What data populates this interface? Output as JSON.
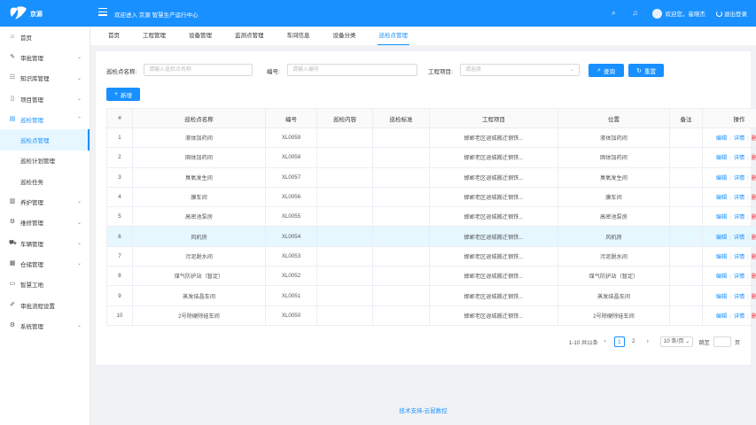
{
  "header": {
    "logo_text": "京源",
    "welcome": "欢迎进入 京源 智慧生产运行中心",
    "user_greeting": "欢迎您，崔晓杰",
    "logout": "退出登录",
    "brand_color": "#1890ff"
  },
  "sidebar": {
    "items": [
      {
        "label": "首页",
        "icon": "home-icon",
        "glyph": "⌂",
        "chevron": ""
      },
      {
        "label": "审批管理",
        "icon": "approval-icon",
        "glyph": "✎",
        "chevron": "⌄"
      },
      {
        "label": "知识库管理",
        "icon": "library-icon",
        "glyph": "☷",
        "chevron": "⌄"
      },
      {
        "label": "项目管理",
        "icon": "project-icon",
        "glyph": "▯",
        "chevron": "⌄"
      },
      {
        "label": "巡检管理",
        "icon": "inspection-icon",
        "glyph": "▤",
        "chevron": "⌃"
      }
    ],
    "sub_items": [
      {
        "label": "巡检点管理"
      },
      {
        "label": "巡检计划管理"
      },
      {
        "label": "巡检任务"
      }
    ],
    "items_after": [
      {
        "label": "养护管理",
        "icon": "maintenance-icon",
        "glyph": "▥",
        "chevron": "⌄"
      },
      {
        "label": "维修管理",
        "icon": "repair-icon",
        "glyph": "⚙",
        "chevron": "⌄"
      },
      {
        "label": "车辆管理",
        "icon": "vehicle-icon",
        "glyph": "⛟",
        "chevron": "⌄"
      },
      {
        "label": "仓储管理",
        "icon": "warehouse-icon",
        "glyph": "▦",
        "chevron": "⌄"
      },
      {
        "label": "智慧工地",
        "icon": "site-icon",
        "glyph": "▭",
        "chevron": ""
      },
      {
        "label": "审批流程设置",
        "icon": "workflow-icon",
        "glyph": "✐",
        "chevron": ""
      },
      {
        "label": "系统管理",
        "icon": "settings-icon",
        "glyph": "⚙",
        "chevron": "⌄"
      }
    ]
  },
  "tabs": [
    "首页",
    "工程管理",
    "设备管理",
    "监测点管理",
    "车间信息",
    "设备分类",
    "巡检点管理"
  ],
  "filters": {
    "name_label": "巡检点名称:",
    "name_placeholder": "请输入巡检点名称",
    "code_label": "编号:",
    "code_placeholder": "请输入编号",
    "project_label": "工程项目:",
    "project_placeholder": "请选择",
    "search_button": "查询",
    "reset_button": "重置",
    "add_button": "新增"
  },
  "table": {
    "columns": [
      "#",
      "巡检点名称",
      "编号",
      "巡检内容",
      "巡检标准",
      "工程项目",
      "位置",
      "备注",
      "操作"
    ],
    "actions": {
      "edit": "编辑",
      "detail": "详情",
      "delete": "删除"
    },
    "rows": [
      {
        "no": "1",
        "name": "液体加药间",
        "code": "XL0059",
        "content": "",
        "standard": "",
        "project": "邯郸老区退城搬迁钢铁...",
        "location": "液体加药间",
        "remark": ""
      },
      {
        "no": "2",
        "name": "固体加药间",
        "code": "XL0058",
        "content": "",
        "standard": "",
        "project": "邯郸老区退城搬迁钢铁...",
        "location": "固体加药间",
        "remark": ""
      },
      {
        "no": "3",
        "name": "臭氧发生间",
        "code": "XL0057",
        "content": "",
        "standard": "",
        "project": "邯郸老区退城搬迁钢铁...",
        "location": "臭氧发生间",
        "remark": ""
      },
      {
        "no": "4",
        "name": "膜车间",
        "code": "XL0056",
        "content": "",
        "standard": "",
        "project": "邯郸老区退城搬迁钢铁...",
        "location": "膜车间",
        "remark": ""
      },
      {
        "no": "5",
        "name": "高密池泵房",
        "code": "XL0055",
        "content": "",
        "standard": "",
        "project": "邯郸老区退城搬迁钢铁...",
        "location": "高密池泵房",
        "remark": ""
      },
      {
        "no": "6",
        "name": "风机房",
        "code": "XL0054",
        "content": "",
        "standard": "",
        "project": "邯郸老区退城搬迁钢铁...",
        "location": "风机房",
        "remark": ""
      },
      {
        "no": "7",
        "name": "污泥脱水间",
        "code": "XL0053",
        "content": "",
        "standard": "",
        "project": "邯郸老区退城搬迁钢铁...",
        "location": "污泥脱水间",
        "remark": ""
      },
      {
        "no": "8",
        "name": "煤气防护站（暂定）",
        "code": "XL0052",
        "content": "",
        "standard": "",
        "project": "邯郸老区退城搬迁钢铁...",
        "location": "煤气防护站（暂定）",
        "remark": ""
      },
      {
        "no": "9",
        "name": "蒸发结晶车间",
        "code": "XL0051",
        "content": "",
        "standard": "",
        "project": "邯郸老区退城搬迁钢铁...",
        "location": "蒸发结晶车间",
        "remark": ""
      },
      {
        "no": "10",
        "name": "2号除硬除硅车间",
        "code": "XL0050",
        "content": "",
        "standard": "",
        "project": "邯郸老区退城搬迁钢铁...",
        "location": "2号除硬除硅车间",
        "remark": ""
      }
    ]
  },
  "pagination": {
    "summary": "1-10 共11条",
    "pages": [
      "1",
      "2"
    ],
    "page_size": "10 条/页",
    "jump_label": "跳至",
    "page_unit": "页"
  },
  "footer": "技术支持-云昆数控"
}
